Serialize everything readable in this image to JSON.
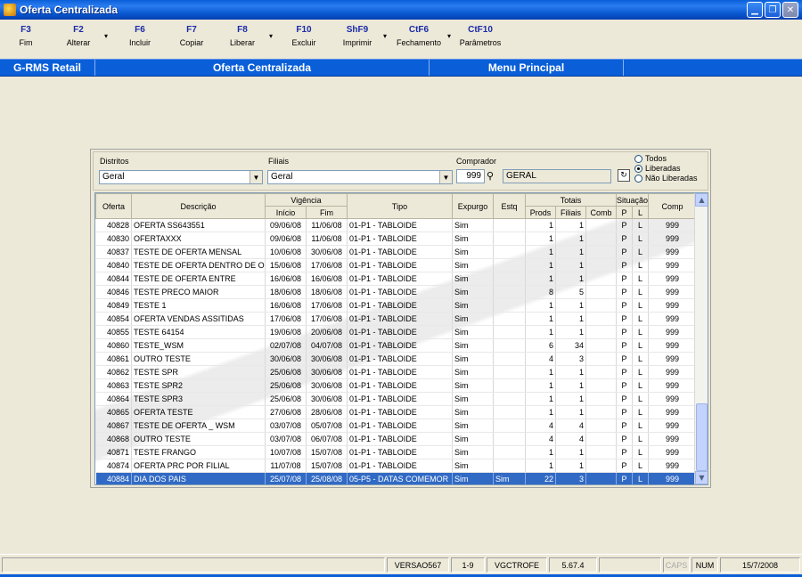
{
  "window": {
    "title": "Oferta Centralizada"
  },
  "toolbar": [
    {
      "key": "F3",
      "label": "Fim"
    },
    {
      "key": "F2",
      "label": "Alterar"
    },
    {
      "key": "F6",
      "label": "Incluir"
    },
    {
      "key": "F7",
      "label": "Copiar"
    },
    {
      "key": "F8",
      "label": "Liberar"
    },
    {
      "key": "F10",
      "label": "Excluir"
    },
    {
      "key": "ShF9",
      "label": "Imprimir"
    },
    {
      "key": "CtF6",
      "label": "Fechamento"
    },
    {
      "key": "CtF10",
      "label": "Parâmetros"
    }
  ],
  "menustrip": {
    "app": "G-RMS Retail",
    "screen": "Oferta Centralizada",
    "menu": "Menu Principal"
  },
  "filters": {
    "distritos_label": "Distritos",
    "distritos_value": "Geral",
    "filiais_label": "Filiais",
    "filiais_value": "Geral",
    "comprador_label": "Comprador",
    "comprador_code": "999",
    "comprador_name": "GERAL",
    "radio_todos": "Todos",
    "radio_liberadas": "Liberadas",
    "radio_nao_liberadas": "Não Liberadas",
    "selected_radio": "Liberadas"
  },
  "grid": {
    "headers": {
      "oferta": "Oferta",
      "descricao": "Descrição",
      "vigencia": "Vigência",
      "inicio": "Início",
      "fim": "Fim",
      "tipo": "Tipo",
      "expurgo": "Expurgo",
      "estq": "Estq",
      "totais": "Totais",
      "prods": "Prods",
      "filiais": "Filiais",
      "comb": "Comb",
      "situacao": "Situação",
      "p": "P",
      "l": "L",
      "comp": "Comp"
    },
    "rows": [
      {
        "oferta": "40828",
        "descricao": "OFERTA SS643551",
        "inicio": "09/06/08",
        "fim": "11/06/08",
        "tipo": "01-P1 - TABLOIDE",
        "expurgo": "Sim",
        "estq": "",
        "prods": "1",
        "filiais": "1",
        "comb": "",
        "p": "P",
        "l": "L",
        "comp": "999"
      },
      {
        "oferta": "40830",
        "descricao": "OFERTAXXX",
        "inicio": "09/06/08",
        "fim": "11/06/08",
        "tipo": "01-P1 - TABLOIDE",
        "expurgo": "Sim",
        "estq": "",
        "prods": "1",
        "filiais": "1",
        "comb": "",
        "p": "P",
        "l": "L",
        "comp": "999"
      },
      {
        "oferta": "40837",
        "descricao": "TESTE DE OFERTA MENSAL",
        "inicio": "10/06/08",
        "fim": "30/06/08",
        "tipo": "01-P1 - TABLOIDE",
        "expurgo": "Sim",
        "estq": "",
        "prods": "1",
        "filiais": "1",
        "comb": "",
        "p": "P",
        "l": "L",
        "comp": "999"
      },
      {
        "oferta": "40840",
        "descricao": "TESTE DE OFERTA DENTRO DE OF",
        "inicio": "15/06/08",
        "fim": "17/06/08",
        "tipo": "01-P1 - TABLOIDE",
        "expurgo": "Sim",
        "estq": "",
        "prods": "1",
        "filiais": "1",
        "comb": "",
        "p": "P",
        "l": "L",
        "comp": "999"
      },
      {
        "oferta": "40844",
        "descricao": "TESTE DE OFERTA ENTRE",
        "inicio": "16/06/08",
        "fim": "16/06/08",
        "tipo": "01-P1 - TABLOIDE",
        "expurgo": "Sim",
        "estq": "",
        "prods": "1",
        "filiais": "1",
        "comb": "",
        "p": "P",
        "l": "L",
        "comp": "999"
      },
      {
        "oferta": "40846",
        "descricao": "TESTE PRECO MAIOR",
        "inicio": "18/06/08",
        "fim": "18/06/08",
        "tipo": "01-P1 - TABLOIDE",
        "expurgo": "Sim",
        "estq": "",
        "prods": "8",
        "filiais": "5",
        "comb": "",
        "p": "P",
        "l": "L",
        "comp": "999"
      },
      {
        "oferta": "40849",
        "descricao": "TESTE 1",
        "inicio": "16/06/08",
        "fim": "17/06/08",
        "tipo": "01-P1 - TABLOIDE",
        "expurgo": "Sim",
        "estq": "",
        "prods": "1",
        "filiais": "1",
        "comb": "",
        "p": "P",
        "l": "L",
        "comp": "999"
      },
      {
        "oferta": "40854",
        "descricao": "OFERTA VENDAS ASSITIDAS",
        "inicio": "17/06/08",
        "fim": "17/06/08",
        "tipo": "01-P1 - TABLOIDE",
        "expurgo": "Sim",
        "estq": "",
        "prods": "1",
        "filiais": "1",
        "comb": "",
        "p": "P",
        "l": "L",
        "comp": "999"
      },
      {
        "oferta": "40855",
        "descricao": "TESTE 64154",
        "inicio": "19/06/08",
        "fim": "20/06/08",
        "tipo": "01-P1 - TABLOIDE",
        "expurgo": "Sim",
        "estq": "",
        "prods": "1",
        "filiais": "1",
        "comb": "",
        "p": "P",
        "l": "L",
        "comp": "999"
      },
      {
        "oferta": "40860",
        "descricao": "TESTE_WSM",
        "inicio": "02/07/08",
        "fim": "04/07/08",
        "tipo": "01-P1 - TABLOIDE",
        "expurgo": "Sim",
        "estq": "",
        "prods": "6",
        "filiais": "34",
        "comb": "",
        "p": "P",
        "l": "L",
        "comp": "999"
      },
      {
        "oferta": "40861",
        "descricao": "OUTRO TESTE",
        "inicio": "30/06/08",
        "fim": "30/06/08",
        "tipo": "01-P1 - TABLOIDE",
        "expurgo": "Sim",
        "estq": "",
        "prods": "4",
        "filiais": "3",
        "comb": "",
        "p": "P",
        "l": "L",
        "comp": "999"
      },
      {
        "oferta": "40862",
        "descricao": "TESTE SPR",
        "inicio": "25/06/08",
        "fim": "30/06/08",
        "tipo": "01-P1 - TABLOIDE",
        "expurgo": "Sim",
        "estq": "",
        "prods": "1",
        "filiais": "1",
        "comb": "",
        "p": "P",
        "l": "L",
        "comp": "999"
      },
      {
        "oferta": "40863",
        "descricao": "TESTE SPR2",
        "inicio": "25/06/08",
        "fim": "30/06/08",
        "tipo": "01-P1 - TABLOIDE",
        "expurgo": "Sim",
        "estq": "",
        "prods": "1",
        "filiais": "1",
        "comb": "",
        "p": "P",
        "l": "L",
        "comp": "999"
      },
      {
        "oferta": "40864",
        "descricao": "TESTE SPR3",
        "inicio": "25/06/08",
        "fim": "30/06/08",
        "tipo": "01-P1 - TABLOIDE",
        "expurgo": "Sim",
        "estq": "",
        "prods": "1",
        "filiais": "1",
        "comb": "",
        "p": "P",
        "l": "L",
        "comp": "999"
      },
      {
        "oferta": "40865",
        "descricao": "OFERTA TESTE",
        "inicio": "27/06/08",
        "fim": "28/06/08",
        "tipo": "01-P1 - TABLOIDE",
        "expurgo": "Sim",
        "estq": "",
        "prods": "1",
        "filiais": "1",
        "comb": "",
        "p": "P",
        "l": "L",
        "comp": "999"
      },
      {
        "oferta": "40867",
        "descricao": "TESTE DE OFERTA _ WSM",
        "inicio": "03/07/08",
        "fim": "05/07/08",
        "tipo": "01-P1 - TABLOIDE",
        "expurgo": "Sim",
        "estq": "",
        "prods": "4",
        "filiais": "4",
        "comb": "",
        "p": "P",
        "l": "L",
        "comp": "999"
      },
      {
        "oferta": "40868",
        "descricao": "OUTRO TESTE",
        "inicio": "03/07/08",
        "fim": "06/07/08",
        "tipo": "01-P1 - TABLOIDE",
        "expurgo": "Sim",
        "estq": "",
        "prods": "4",
        "filiais": "4",
        "comb": "",
        "p": "P",
        "l": "L",
        "comp": "999"
      },
      {
        "oferta": "40871",
        "descricao": "TESTE FRANGO",
        "inicio": "10/07/08",
        "fim": "15/07/08",
        "tipo": "01-P1 - TABLOIDE",
        "expurgo": "Sim",
        "estq": "",
        "prods": "1",
        "filiais": "1",
        "comb": "",
        "p": "P",
        "l": "L",
        "comp": "999"
      },
      {
        "oferta": "40874",
        "descricao": "OFERTA PRC POR FILIAL",
        "inicio": "11/07/08",
        "fim": "15/07/08",
        "tipo": "01-P1 - TABLOIDE",
        "expurgo": "Sim",
        "estq": "",
        "prods": "1",
        "filiais": "1",
        "comb": "",
        "p": "P",
        "l": "L",
        "comp": "999"
      },
      {
        "oferta": "40884",
        "descricao": "DIA DOS PAIS",
        "inicio": "25/07/08",
        "fim": "25/08/08",
        "tipo": "05-P5 - DATAS COMEMOR",
        "expurgo": "Sim",
        "estq": "Sim",
        "prods": "22",
        "filiais": "3",
        "comb": "",
        "p": "P",
        "l": "L",
        "comp": "999",
        "selected": true
      }
    ]
  },
  "statusbar": {
    "versao": "VERSAO567",
    "range": "1-9",
    "user": "VGCTROFE",
    "build": "5.67.4",
    "caps": "CAPS",
    "num": "NUM",
    "date": "15/7/2008"
  },
  "colors": {
    "titlebar": "#0a5fd8",
    "selection": "#316ac5",
    "toolbar_key": "#1a2aa8"
  },
  "icons": {
    "app": "app-icon",
    "find": "binoculars-icon",
    "refresh": "refresh-icon"
  }
}
